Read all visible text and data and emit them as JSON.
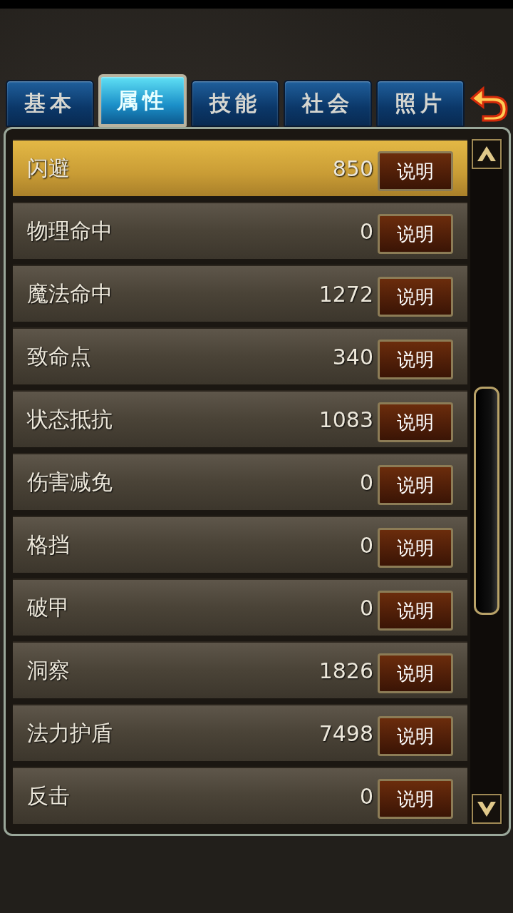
{
  "tabs": [
    {
      "label": "基本",
      "selected": false
    },
    {
      "label": "属性",
      "selected": true
    },
    {
      "label": "技能",
      "selected": false
    },
    {
      "label": "社会",
      "selected": false
    },
    {
      "label": "照片",
      "selected": false
    }
  ],
  "rows": [
    {
      "name": "闪避",
      "value": "850",
      "button": "说明",
      "selected": true
    },
    {
      "name": "物理命中",
      "value": "0",
      "button": "说明",
      "selected": false
    },
    {
      "name": "魔法命中",
      "value": "1272",
      "button": "说明",
      "selected": false
    },
    {
      "name": "致命点",
      "value": "340",
      "button": "说明",
      "selected": false
    },
    {
      "name": "状态抵抗",
      "value": "1083",
      "button": "说明",
      "selected": false
    },
    {
      "name": "伤害减免",
      "value": "0",
      "button": "说明",
      "selected": false
    },
    {
      "name": "格挡",
      "value": "0",
      "button": "说明",
      "selected": false
    },
    {
      "name": "破甲",
      "value": "0",
      "button": "说明",
      "selected": false
    },
    {
      "name": "洞察",
      "value": "1826",
      "button": "说明",
      "selected": false
    },
    {
      "name": "法力护盾",
      "value": "7498",
      "button": "说明",
      "selected": false
    },
    {
      "name": "反击",
      "value": "0",
      "button": "说明",
      "selected": false
    }
  ]
}
